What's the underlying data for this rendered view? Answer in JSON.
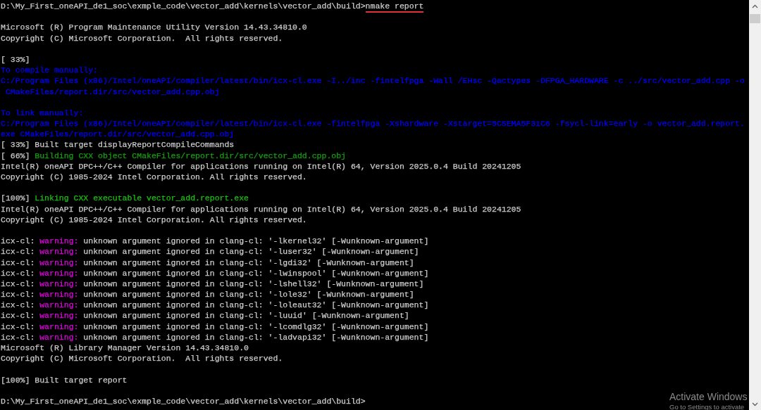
{
  "terminal": {
    "lines": [
      {
        "segments": [
          {
            "text": "D:\\My_First_oneAPI_de1_soc\\exmple_code\\vector_add\\kernels\\vector_add\\build>",
            "color": "#cccccc",
            "underlined": false
          },
          {
            "text": "nmake report",
            "color": "#cccccc",
            "underlined": true
          }
        ]
      },
      {
        "kind": "blank"
      },
      {
        "segments": [
          {
            "text": "Microsoft (R) Program Maintenance Utility Version 14.43.34810.0",
            "color": "#cccccc",
            "underlined": false
          }
        ]
      },
      {
        "segments": [
          {
            "text": "Copyright (C) Microsoft Corporation.  All rights reserved.",
            "color": "#cccccc",
            "underlined": false
          }
        ]
      },
      {
        "kind": "blank"
      },
      {
        "segments": [
          {
            "text": "[ 33%]",
            "color": "#cccccc",
            "underlined": false
          }
        ]
      },
      {
        "segments": [
          {
            "text": "To compile manually:",
            "color": "#0000ff",
            "underlined": false
          }
        ]
      },
      {
        "segments": [
          {
            "text": "C:/Program Files (x86)/Intel/oneAPI/compiler/latest/bin/icx-cl.exe -I../inc -fintelfpga -Wall /EHsc -Qactypes -DFPGA_HARDWARE -c ../src/vector_add.cpp -o",
            "color": "#0000ff",
            "underlined": false
          }
        ]
      },
      {
        "segments": [
          {
            "text": " CMakeFiles/report.dir/src/vector_add.cpp.obj",
            "color": "#0000ff",
            "underlined": false
          }
        ]
      },
      {
        "kind": "blank"
      },
      {
        "segments": [
          {
            "text": "To link manually:",
            "color": "#0000ff",
            "underlined": false
          }
        ]
      },
      {
        "segments": [
          {
            "text": "C:/Program Files (x86)/Intel/oneAPI/compiler/latest/bin/icx-cl.exe -fintelfpga -Xshardware -Xstarget=5CSEMA5F31C6 -fsycl-link=early -o vector_add.report.",
            "color": "#0000ff",
            "underlined": false
          }
        ]
      },
      {
        "segments": [
          {
            "text": "exe CMakeFiles/report.dir/src/vector_add.cpp.obj",
            "color": "#0000ff",
            "underlined": false
          }
        ]
      },
      {
        "segments": [
          {
            "text": "[ 33%] Built target displayReportCompileCommands",
            "color": "#cccccc",
            "underlined": false
          }
        ]
      },
      {
        "segments": [
          {
            "text": "[ 66%] ",
            "color": "#cccccc",
            "underlined": false
          },
          {
            "text": "Building CXX object CMakeFiles/report.dir/src/vector_add.cpp.obj",
            "color": "#13a10e",
            "underlined": false
          }
        ]
      },
      {
        "segments": [
          {
            "text": "Intel(R) oneAPI DPC++/C++ Compiler for applications running on Intel(R) 64, Version 2025.0.4 Build 20241205",
            "color": "#cccccc",
            "underlined": false
          }
        ]
      },
      {
        "segments": [
          {
            "text": "Copyright (C) 1985-2024 Intel Corporation. All rights reserved.",
            "color": "#cccccc",
            "underlined": false
          }
        ]
      },
      {
        "kind": "blank"
      },
      {
        "segments": [
          {
            "text": "[100%] ",
            "color": "#cccccc",
            "underlined": false
          },
          {
            "text": "Linking CXX executable vector_add.report.exe",
            "color": "#16c60c",
            "underlined": false
          }
        ]
      },
      {
        "segments": [
          {
            "text": "Intel(R) oneAPI DPC++/C++ Compiler for applications running on Intel(R) 64, Version 2025.0.4 Build 20241205",
            "color": "#cccccc",
            "underlined": false
          }
        ]
      },
      {
        "segments": [
          {
            "text": "Copyright (C) 1985-2024 Intel Corporation. All rights reserved.",
            "color": "#cccccc",
            "underlined": false
          }
        ]
      },
      {
        "kind": "blank"
      },
      {
        "segments": [
          {
            "text": "icx-cl: ",
            "color": "#cccccc",
            "underlined": false
          },
          {
            "text": "warning:",
            "color": "#e000e0",
            "underlined": false
          },
          {
            "text": " unknown argument ignored in clang-cl: '-lkernel32' [-Wunknown-argument]",
            "color": "#cccccc",
            "underlined": false
          }
        ]
      },
      {
        "segments": [
          {
            "text": "icx-cl: ",
            "color": "#cccccc",
            "underlined": false
          },
          {
            "text": "warning:",
            "color": "#e000e0",
            "underlined": false
          },
          {
            "text": " unknown argument ignored in clang-cl: '-luser32' [-Wunknown-argument]",
            "color": "#cccccc",
            "underlined": false
          }
        ]
      },
      {
        "segments": [
          {
            "text": "icx-cl: ",
            "color": "#cccccc",
            "underlined": false
          },
          {
            "text": "warning:",
            "color": "#e000e0",
            "underlined": false
          },
          {
            "text": " unknown argument ignored in clang-cl: '-lgdi32' [-Wunknown-argument]",
            "color": "#cccccc",
            "underlined": false
          }
        ]
      },
      {
        "segments": [
          {
            "text": "icx-cl: ",
            "color": "#cccccc",
            "underlined": false
          },
          {
            "text": "warning:",
            "color": "#e000e0",
            "underlined": false
          },
          {
            "text": " unknown argument ignored in clang-cl: '-lwinspool' [-Wunknown-argument]",
            "color": "#cccccc",
            "underlined": false
          }
        ]
      },
      {
        "segments": [
          {
            "text": "icx-cl: ",
            "color": "#cccccc",
            "underlined": false
          },
          {
            "text": "warning:",
            "color": "#e000e0",
            "underlined": false
          },
          {
            "text": " unknown argument ignored in clang-cl: '-lshell32' [-Wunknown-argument]",
            "color": "#cccccc",
            "underlined": false
          }
        ]
      },
      {
        "segments": [
          {
            "text": "icx-cl: ",
            "color": "#cccccc",
            "underlined": false
          },
          {
            "text": "warning:",
            "color": "#e000e0",
            "underlined": false
          },
          {
            "text": " unknown argument ignored in clang-cl: '-lole32' [-Wunknown-argument]",
            "color": "#cccccc",
            "underlined": false
          }
        ]
      },
      {
        "segments": [
          {
            "text": "icx-cl: ",
            "color": "#cccccc",
            "underlined": false
          },
          {
            "text": "warning:",
            "color": "#e000e0",
            "underlined": false
          },
          {
            "text": " unknown argument ignored in clang-cl: '-loleaut32' [-Wunknown-argument]",
            "color": "#cccccc",
            "underlined": false
          }
        ]
      },
      {
        "segments": [
          {
            "text": "icx-cl: ",
            "color": "#cccccc",
            "underlined": false
          },
          {
            "text": "warning:",
            "color": "#e000e0",
            "underlined": false
          },
          {
            "text": " unknown argument ignored in clang-cl: '-luuid' [-Wunknown-argument]",
            "color": "#cccccc",
            "underlined": false
          }
        ]
      },
      {
        "segments": [
          {
            "text": "icx-cl: ",
            "color": "#cccccc",
            "underlined": false
          },
          {
            "text": "warning:",
            "color": "#e000e0",
            "underlined": false
          },
          {
            "text": " unknown argument ignored in clang-cl: '-lcomdlg32' [-Wunknown-argument]",
            "color": "#cccccc",
            "underlined": false
          }
        ]
      },
      {
        "segments": [
          {
            "text": "icx-cl: ",
            "color": "#cccccc",
            "underlined": false
          },
          {
            "text": "warning:",
            "color": "#e000e0",
            "underlined": false
          },
          {
            "text": " unknown argument ignored in clang-cl: '-ladvapi32' [-Wunknown-argument]",
            "color": "#cccccc",
            "underlined": false
          }
        ]
      },
      {
        "segments": [
          {
            "text": "Microsoft (R) Library Manager Version 14.43.34810.0",
            "color": "#cccccc",
            "underlined": false
          }
        ]
      },
      {
        "segments": [
          {
            "text": "Copyright (C) Microsoft Corporation.  All rights reserved.",
            "color": "#cccccc",
            "underlined": false
          }
        ]
      },
      {
        "kind": "blank"
      },
      {
        "segments": [
          {
            "text": "[100%] Built target report",
            "color": "#cccccc",
            "underlined": false
          }
        ]
      },
      {
        "kind": "blank"
      },
      {
        "segments": [
          {
            "text": "D:\\My_First_oneAPI_de1_soc\\exmple_code\\vector_add\\kernels\\vector_add\\build>",
            "color": "#cccccc",
            "underlined": false
          }
        ]
      }
    ]
  },
  "activation_notice": {
    "title": "Activate Windows",
    "text": "Go to Settings to activate"
  }
}
